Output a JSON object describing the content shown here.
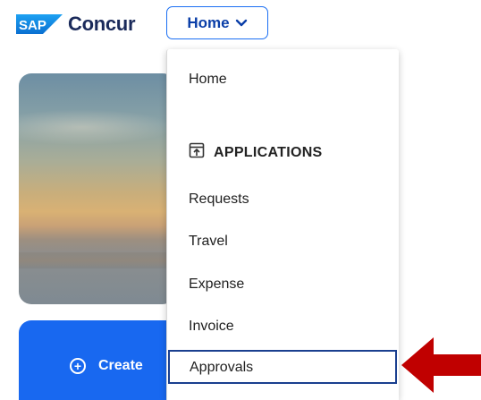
{
  "header": {
    "brand_badge": "SAP",
    "brand_name": "Concur",
    "nav_button_label": "Home",
    "nav_button_icon": "chevron-down-icon"
  },
  "hero": {
    "create_label": "Create",
    "create_icon": "plus-circle-icon"
  },
  "menu": {
    "items_top": [
      {
        "label": "Home"
      }
    ],
    "section_title": "APPLICATIONS",
    "section_icon": "app-launch-icon",
    "items": [
      {
        "label": "Requests"
      },
      {
        "label": "Travel"
      },
      {
        "label": "Expense"
      },
      {
        "label": "Invoice"
      },
      {
        "label": "Approvals",
        "highlighted": true
      }
    ]
  },
  "annotation": {
    "arrow_color": "#c00000",
    "highlight_color": "#1a3f8f"
  },
  "colors": {
    "brand_blue": "#1b6ff3",
    "create_card": "#1868f0",
    "text_dark": "#1f1f1f"
  }
}
